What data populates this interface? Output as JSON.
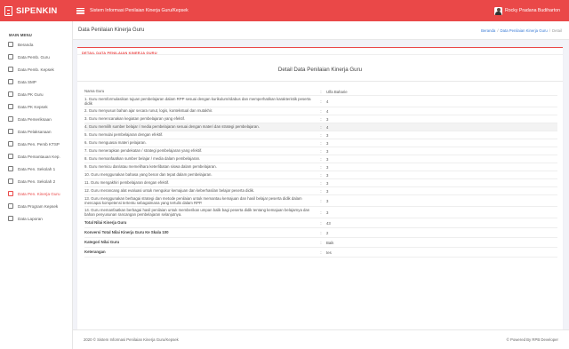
{
  "brand": "SIPENKIN",
  "app_title": "Sistem Informasi Penilaian Kinerja Guru/Kepsek",
  "user_name": "Rocky Pradana Budiharton",
  "sidebar": {
    "heading": "MAIN MENU",
    "items": [
      {
        "label": "Beranda",
        "icon": "home-icon"
      },
      {
        "label": "Data Pemb. Guru",
        "icon": "document-icon"
      },
      {
        "label": "Data Pemb. Kepsek",
        "icon": "document-icon"
      },
      {
        "label": "Data SMP",
        "icon": "school-icon"
      },
      {
        "label": "Data PK Guru",
        "icon": "folder-icon"
      },
      {
        "label": "Data PK Kepsek",
        "icon": "folder-icon"
      },
      {
        "label": "Data Pemeriksaan",
        "icon": "check-icon"
      },
      {
        "label": "Data Pelaksanaan",
        "icon": "clipboard-icon"
      },
      {
        "label": "Data Pen. Pemb KTSP",
        "icon": "pencil-icon"
      },
      {
        "label": "Data Pemantauan Kep.",
        "icon": "search-icon"
      },
      {
        "label": "Data Pen. Sekolah 1",
        "icon": "gear-icon"
      },
      {
        "label": "Data Pen. Sekolah 2",
        "icon": "gear-icon"
      },
      {
        "label": "Data Pen. Kinerja Guru",
        "icon": "chart-icon"
      },
      {
        "label": "Data Program Kepsek",
        "icon": "book-icon"
      },
      {
        "label": "Data Laporan",
        "icon": "report-icon"
      }
    ],
    "active_index": 12
  },
  "page": {
    "title": "Data Penilaian Kinerja Guru",
    "breadcrumb": [
      "Beranda",
      "Data Penilaian Kinerja Guru",
      "Detail"
    ]
  },
  "card": {
    "header": "DETAIL DATA PENILAIAN KINERJA GURU",
    "title": "Detail Data Penilaian Kinerja Guru"
  },
  "rows": [
    {
      "q": "Nama Guru",
      "v": "Ulfa Baharie"
    },
    {
      "q": "1. Guru memformulasikan tujuan pembelajaran dalam RPP sesuai dengan kurikulum/silabus dan memperhatikan karakteristik peserta didik",
      "v": "4"
    },
    {
      "q": "2. Guru menyusun bahan ajar secara runut, logis, kontekstual dan mutakhir.",
      "v": "4"
    },
    {
      "q": "3. Guru merencanakan kegiatan pembelajaran yang efektif.",
      "v": "3"
    },
    {
      "q": "4. Guru memilih sumber belajar / media pembelajaran sesuai dengan materi dan strategi pembelajaran.",
      "v": "4"
    },
    {
      "q": "5. Guru memulai pembelajaran dengan efektif.",
      "v": "3"
    },
    {
      "q": "6. Guru menguasai materi pelajaran.",
      "v": "3"
    },
    {
      "q": "7. Guru menerapkan pendekatan / strategi pembelajaran yang efektif.",
      "v": "3"
    },
    {
      "q": "8. Guru memanfaatkan sumber belajar / media dalam pembelajaran.",
      "v": "3"
    },
    {
      "q": "9. Guru memicu dan/atau memelihara keterlibatan siswa dalam pembelajaran.",
      "v": "3"
    },
    {
      "q": "10. Guru menggunakan bahasa yang benar dan tepat dalam pembelajaran.",
      "v": "3"
    },
    {
      "q": "11. Guru mengakhiri pembelajaran dengan efektif.",
      "v": "3"
    },
    {
      "q": "12. Guru merancang alat evaluasi untuk mengukur kemajuan dan keberhasilan belajar peserta didik.",
      "v": "3"
    },
    {
      "q": "13. Guru menggunakan berbagai strategi dan metode penilaian untuk memantau kemajuan dan hasil belajar peserta didik dalam mencapai kompetensi tertentu sebagaimana yang tertulis dalam RPP.",
      "v": "3"
    },
    {
      "q": "14. Guru memanfaatkan berbagai hasil penilaian untuk memberikan umpan balik bagi peserta didik tentang kemajuan belajarnya dan bahan penyusunan rancangan pembelajaran selanjutnya.",
      "v": "3"
    },
    {
      "q": "Total Nilai Kinerja Guru",
      "v": "43",
      "bold": true
    },
    {
      "q": "Konversi Total Nilai Kinerja Guru Ke Skala 100",
      "v": "2",
      "bold": true
    },
    {
      "q": "Kategori Nilai Guru",
      "v": "Baik",
      "bold": true
    },
    {
      "q": "Keterangan",
      "v": "tes",
      "bold": true
    }
  ],
  "footer": {
    "left": "2020 © Sistem Informasi Penilaian Kinerja Guru/Kepsek",
    "right": "© Powered By RPB Developer"
  }
}
